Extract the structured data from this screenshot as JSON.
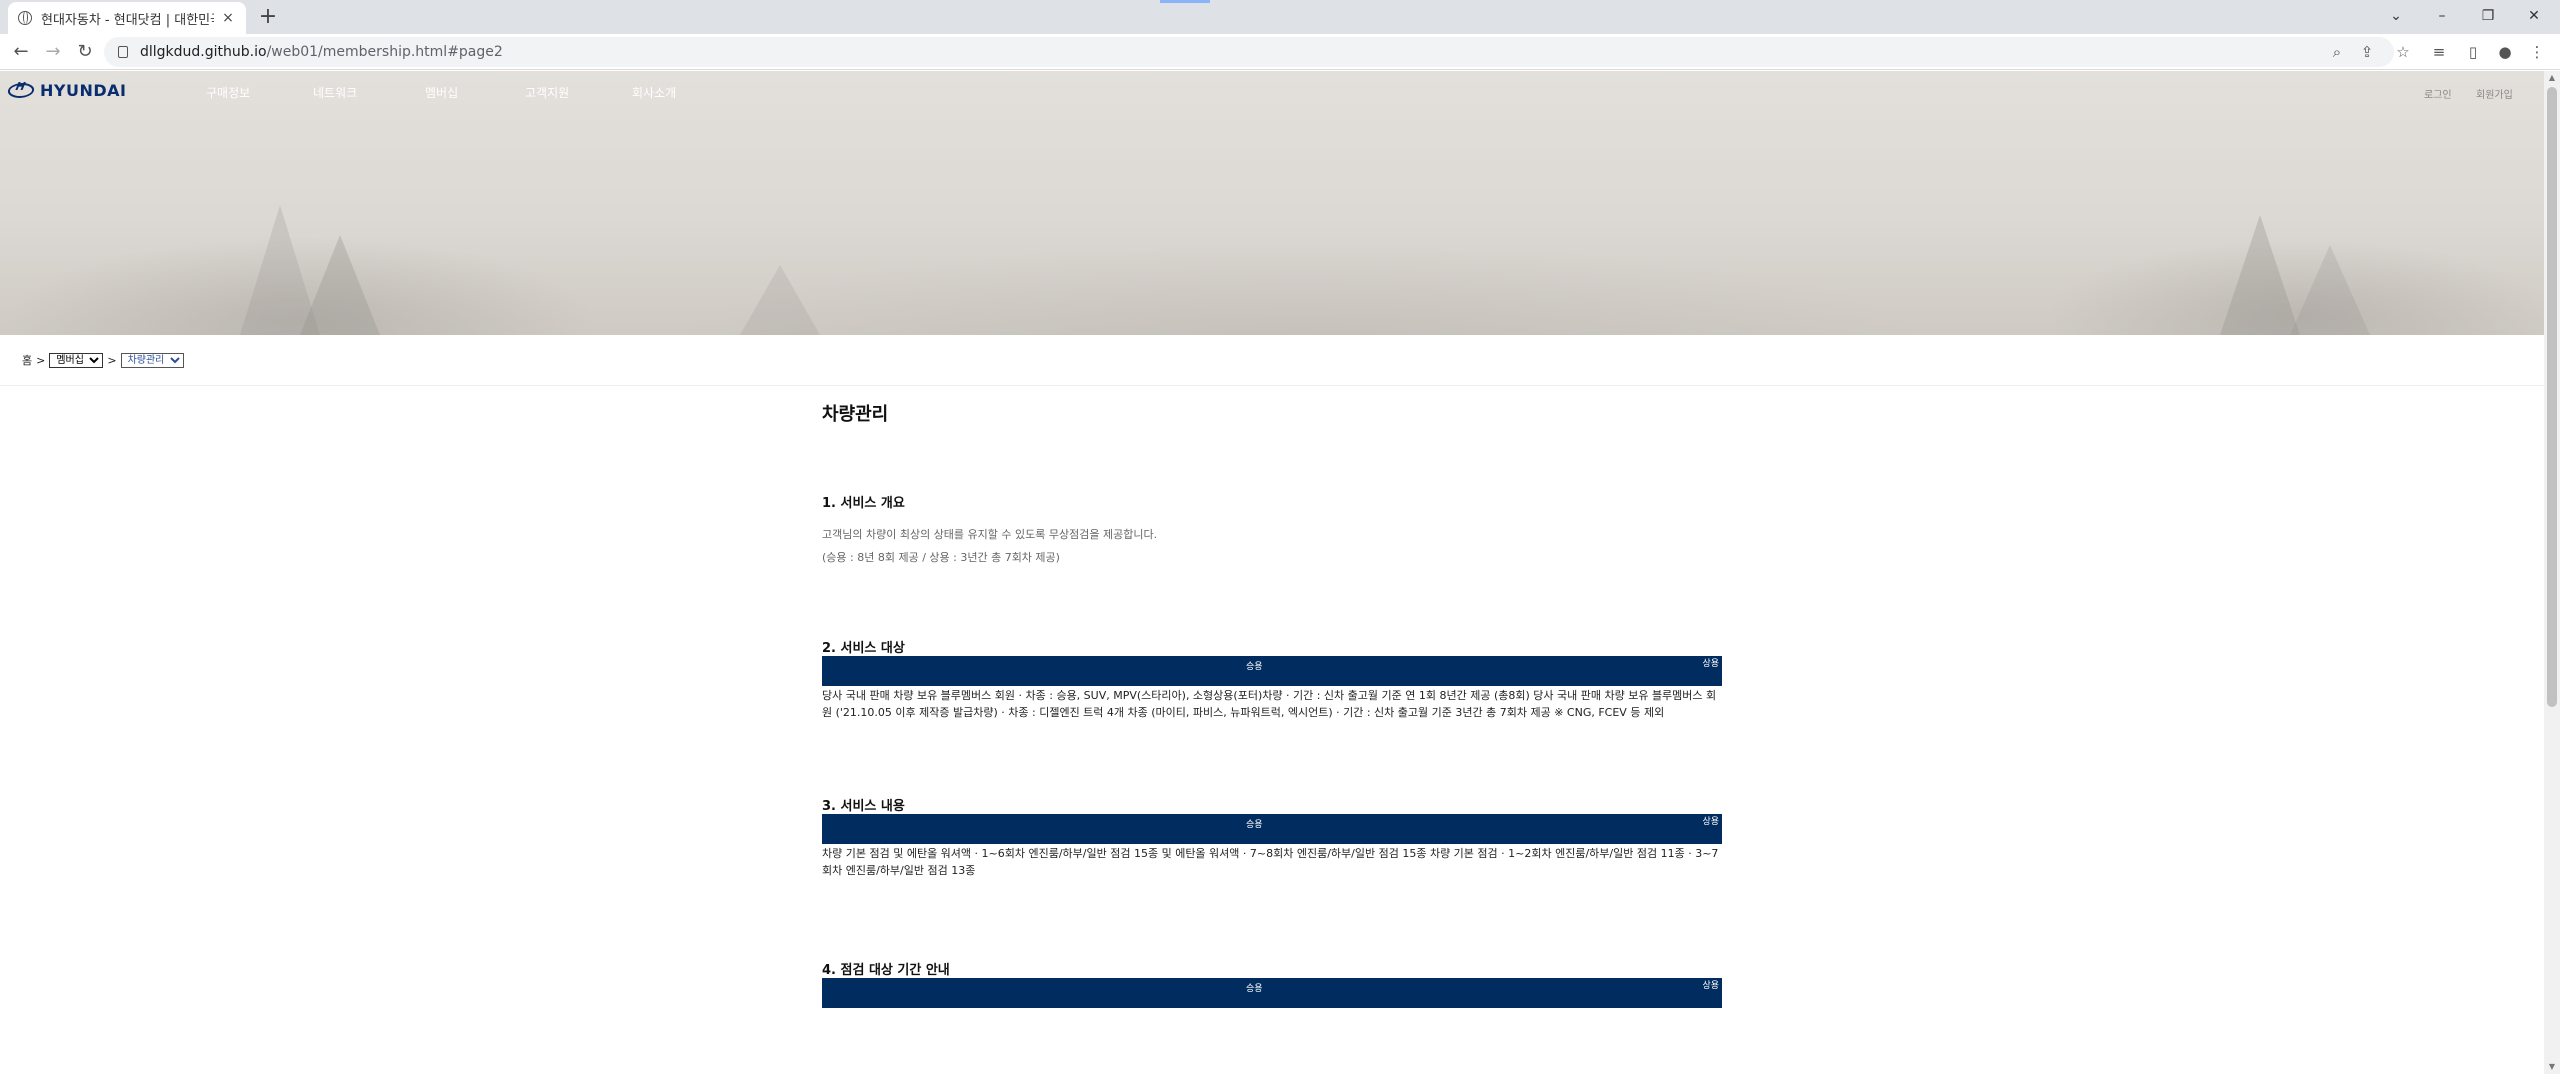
{
  "browser": {
    "tab_title": "현대자동차 - 현대닷컴 | 대한민국",
    "tab_close": "×",
    "new_tab": "+",
    "url_host": "dllgkdud.github.io",
    "url_path": "/web01/membership.html#page2",
    "window": {
      "minimize": "–",
      "restore": "❐",
      "close": "✕",
      "tab_search": "⌄"
    },
    "nav": {
      "back": "←",
      "forward": "→",
      "reload": "↻"
    },
    "toolbar_icons": {
      "zoom": "⌕",
      "share": "⇪",
      "bookmark": "☆",
      "reading_list": "≡",
      "side_panel": "▯",
      "profile": "●",
      "menu": "⋮"
    }
  },
  "site": {
    "logo_text": "HYUNDAI",
    "gnb": [
      "구매정보",
      "네트워크",
      "멤버십",
      "고객지원",
      "회사소개"
    ],
    "util": {
      "login": "로그인",
      "join": "회원가입"
    }
  },
  "breadcrumb": {
    "home": "홈",
    "sep": ">",
    "select1": "멤버십",
    "select2": "차량관리"
  },
  "main": {
    "title": "차량관리",
    "sections": [
      {
        "title": "1. 서비스 개요",
        "lines": [
          "고객님의 차량이 최상의 상태를 유지할 수 있도록 무상점검을 제공합니다.",
          "(승용 : 8년 8회 제공 / 상용 : 3년간 총 7회차 제공)"
        ]
      },
      {
        "title": "2. 서비스 대상",
        "bar_center": "승용",
        "bar_right": "상용",
        "body": "당사 국내 판매 차량 보유 블루멤버스 회원 · 차종 : 승용, SUV, MPV(스타리아), 소형상용(포터)차량 · 기간 : 신차 출고월 기준 연 1회 8년간 제공 (총8회) 당사 국내 판매 차량 보유 블루멤버스 회원 ('21.10.05 이후 제작증 발급차량) · 차종 : 디젤엔진 트럭 4개 차종 (마이티, 파비스, 뉴파워트럭, 엑시언트) · 기간 : 신차 출고월 기준 3년간 총 7회차 제공 ※ CNG, FCEV 등 제외"
      },
      {
        "title": "3. 서비스 내용",
        "bar_center": "승용",
        "bar_right": "상용",
        "body": "차량 기본 점검 및 에탄올 워셔액 · 1~6회차 엔진룸/하부/일반 점검 15종 및 에탄올 워셔액 · 7~8회차 엔진룸/하부/일반 점검 15종 차량 기본 점검     · 1~2회차 엔진룸/하부/일반 점검 11종 · 3~7회차 엔진룸/하부/일반 점검 13종"
      },
      {
        "title": "4. 점검 대상 기간 안내",
        "bar_center": "승용",
        "bar_right": "상용"
      }
    ]
  }
}
